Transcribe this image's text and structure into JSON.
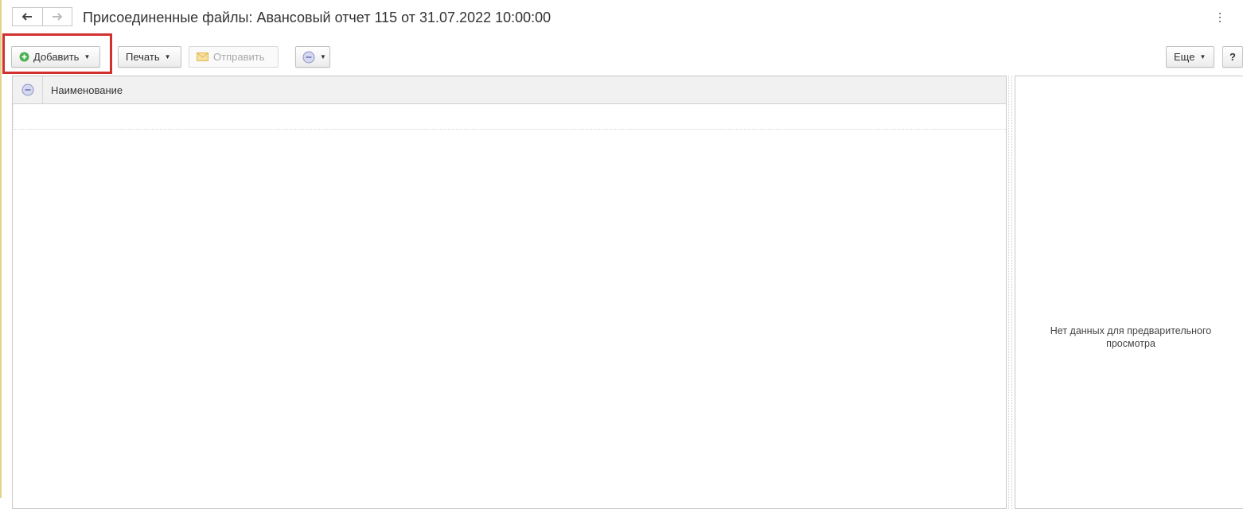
{
  "header": {
    "title": "Присоединенные файлы: Авансовый отчет 115 от 31.07.2022 10:00:00"
  },
  "toolbar": {
    "add_label": "Добавить",
    "print_label": "Печать",
    "send_label": "Отправить",
    "more_label": "Еще",
    "help_label": "?"
  },
  "table": {
    "columns": [
      "Наименование"
    ],
    "rows": []
  },
  "preview": {
    "empty_text": "Нет данных для предварительного просмотра"
  },
  "colors": {
    "highlight": "#d22f2f",
    "add_icon": "#4caf50",
    "send_icon": "#e8c86a"
  }
}
